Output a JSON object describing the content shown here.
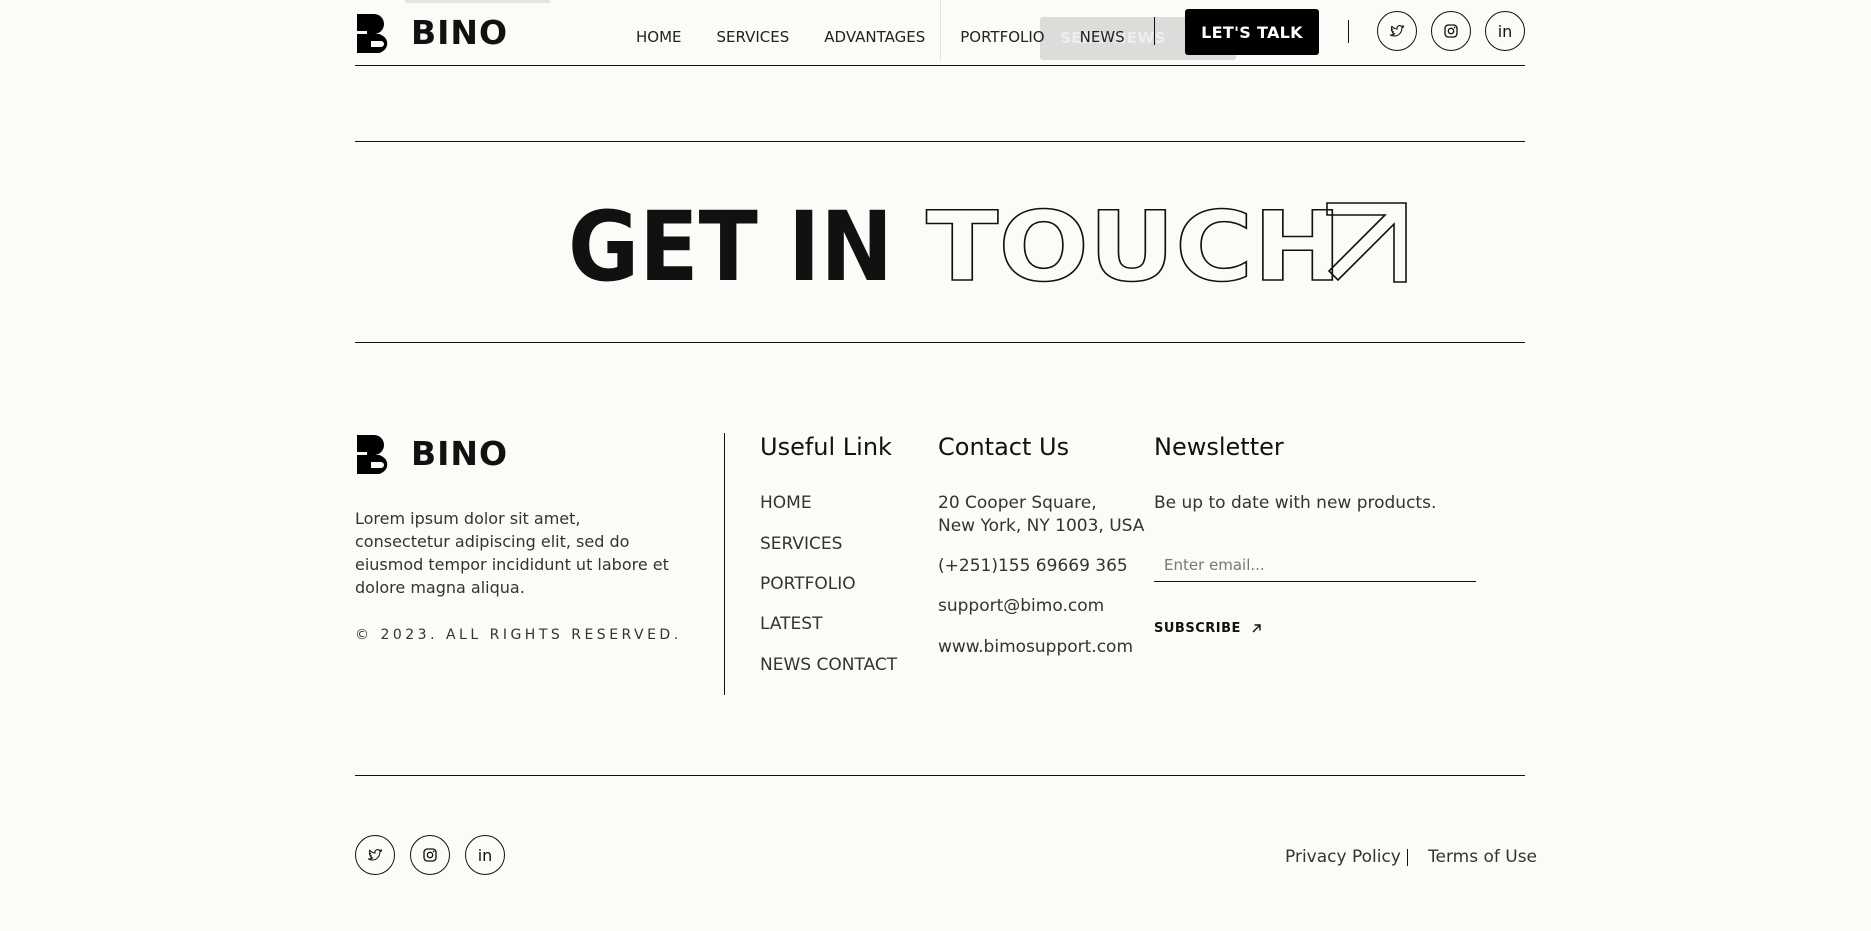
{
  "brand": {
    "name": "BINO"
  },
  "nav": {
    "items": [
      "HOME",
      "SERVICES",
      "ADVANTAGES",
      "PORTFOLIO",
      "NEWS"
    ],
    "ghost_button": "SEND NEWS",
    "cta": "LET'S TALK"
  },
  "social": [
    "twitter-icon",
    "instagram-icon",
    "linkedin-icon"
  ],
  "social_linkedin_text": "in",
  "hero": {
    "solid": "GET IN",
    "outline": "TOUCH"
  },
  "about": {
    "text": "Lorem ipsum dolor sit amet, consectetur adipiscing elit, sed do eiusmod tempor incididunt ut labore et dolore magna aliqua.",
    "copyright": "© 2023. ALL RIGHTS RESERVED."
  },
  "useful_links": {
    "title": "Useful Link",
    "items": [
      "HOME",
      "SERVICES",
      "PORTFOLIO",
      "LATEST",
      "NEWS CONTACT"
    ]
  },
  "contact": {
    "title": "Contact Us",
    "address_line1": "20 Cooper Square,",
    "address_line2": "New York, NY 1003, USA",
    "phone": "(+251)155 69669 365",
    "email": "support@bimo.com",
    "website": "www.bimosupport.com"
  },
  "newsletter": {
    "title": "Newsletter",
    "subtitle": "Be up to date with new products.",
    "placeholder": "Enter email...",
    "button": "SUBSCRIBE"
  },
  "legal": {
    "privacy": "Privacy Policy",
    "terms": "Terms of Use"
  }
}
